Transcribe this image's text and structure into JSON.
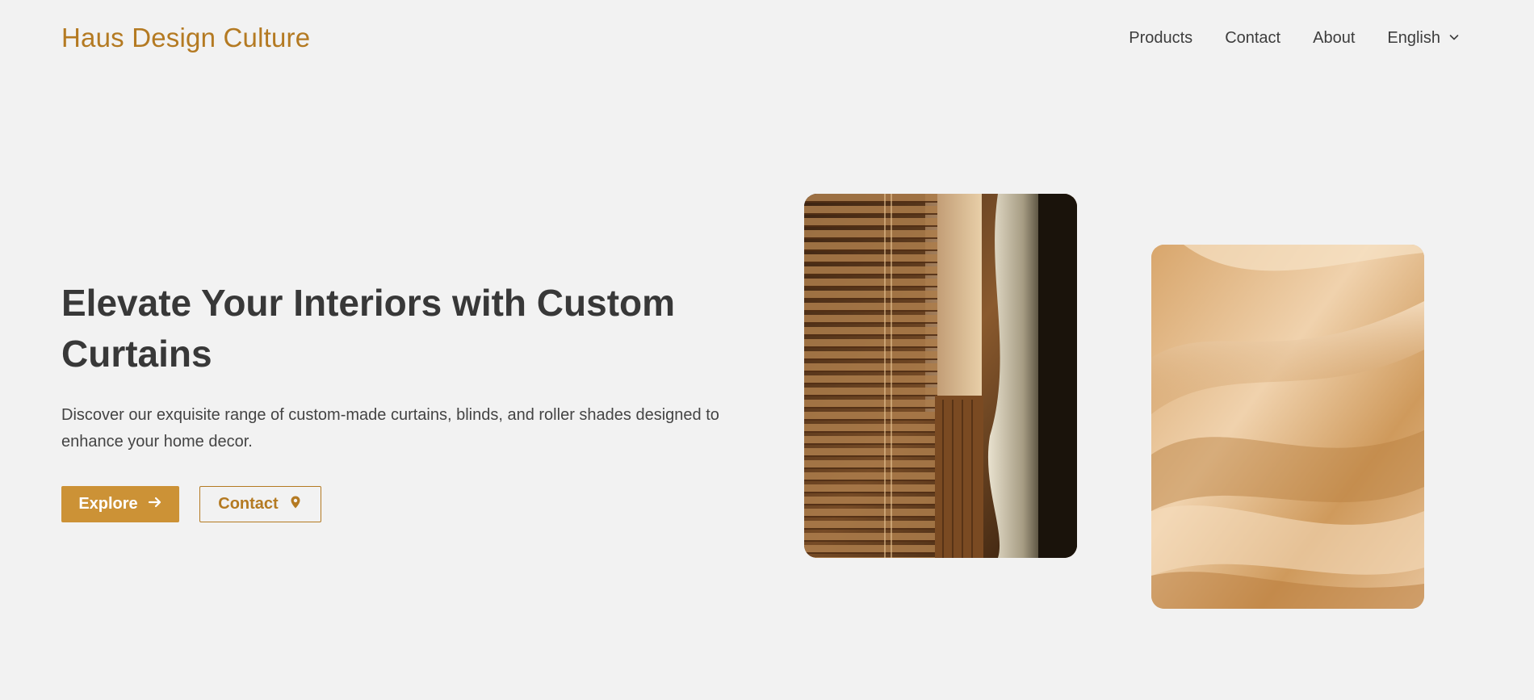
{
  "header": {
    "logo": "Haus Design Culture",
    "nav": {
      "products": "Products",
      "contact": "Contact",
      "about": "About",
      "language": "English"
    }
  },
  "hero": {
    "title": "Elevate Your Interiors with Custom Curtains",
    "description": "Discover our exquisite range of custom-made curtains, blinds, and roller shades designed to enhance your home decor.",
    "explore_label": "Explore",
    "contact_label": "Contact"
  },
  "icons": {
    "language_dropdown": "chevron-down-icon",
    "explore": "arrow-right-icon",
    "contact": "map-pin-icon"
  },
  "colors": {
    "brand": "#b47a22",
    "button_fill": "#cc9236",
    "background": "#f2f2f2",
    "heading": "#383838"
  }
}
